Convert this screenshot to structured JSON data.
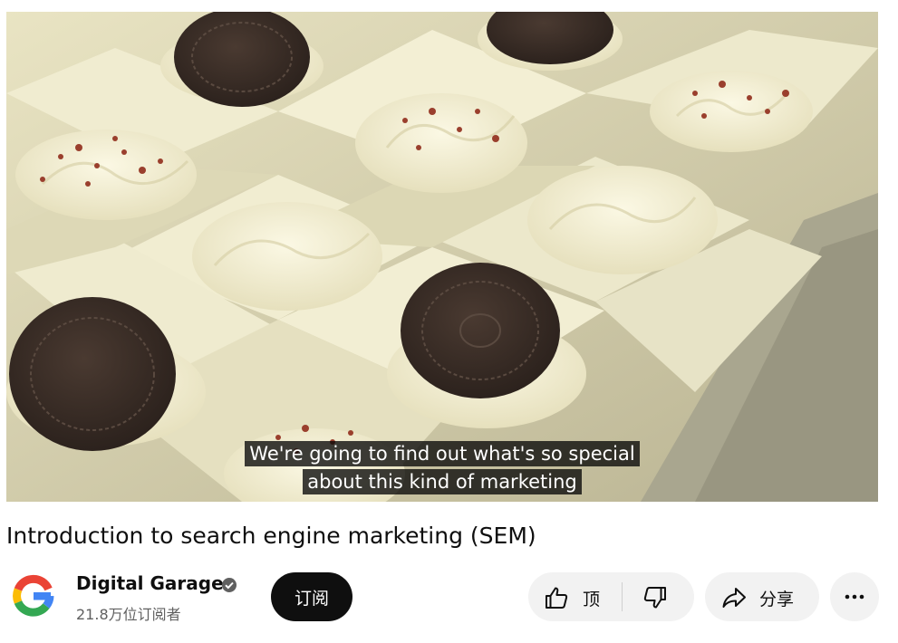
{
  "player": {
    "caption_lines": [
      "We're going to find out what's so special",
      "about this kind of marketing"
    ]
  },
  "video": {
    "title": "Introduction to search engine marketing (SEM)"
  },
  "channel": {
    "name": "Digital Garage",
    "subscriber_count": "21.8万位订阅者",
    "avatar_icon": "google-g-logo-icon",
    "verified_icon": "verified-check-icon"
  },
  "actions": {
    "subscribe_label": "订阅",
    "like_label": "顶",
    "share_label": "分享",
    "icons": {
      "like": "thumbs-up-icon",
      "dislike": "thumbs-down-icon",
      "share": "share-arrow-icon",
      "more": "more-horizontal-icon"
    }
  },
  "colors": {
    "subscribe_bg": "#0f0f0f",
    "chip_bg": "#f2f2f2",
    "caption_bg": "#080808",
    "secondary_text": "#606060"
  }
}
